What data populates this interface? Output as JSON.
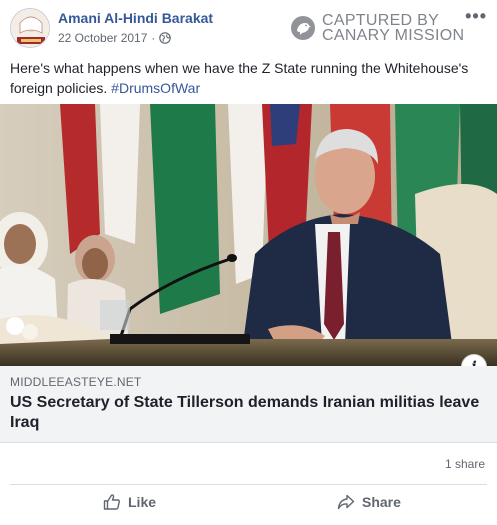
{
  "post": {
    "author": "Amani Al-Hindi Barakat",
    "date": "22 October 2017",
    "date_separator": "·",
    "more_icon": "ellipsis-icon",
    "text": "Here's what happens when we have the Z State running the Whitehouse's foreign policies.",
    "hashtag": "#DrumsOfWar"
  },
  "watermark": {
    "line1": "CAPTURED BY",
    "line2": "CANARY MISSION"
  },
  "link_preview": {
    "domain": "MIDDLEEASTEYE.NET",
    "title": "US Secretary of State Tillerson demands Iranian militias leave Iraq",
    "info_label": "i"
  },
  "stats": {
    "shares": "1 share"
  },
  "actions": {
    "like": "Like",
    "share": "Share"
  },
  "colors": {
    "link_blue": "#365899",
    "secondary_text": "#606770",
    "preview_bg": "#f2f3f5"
  }
}
